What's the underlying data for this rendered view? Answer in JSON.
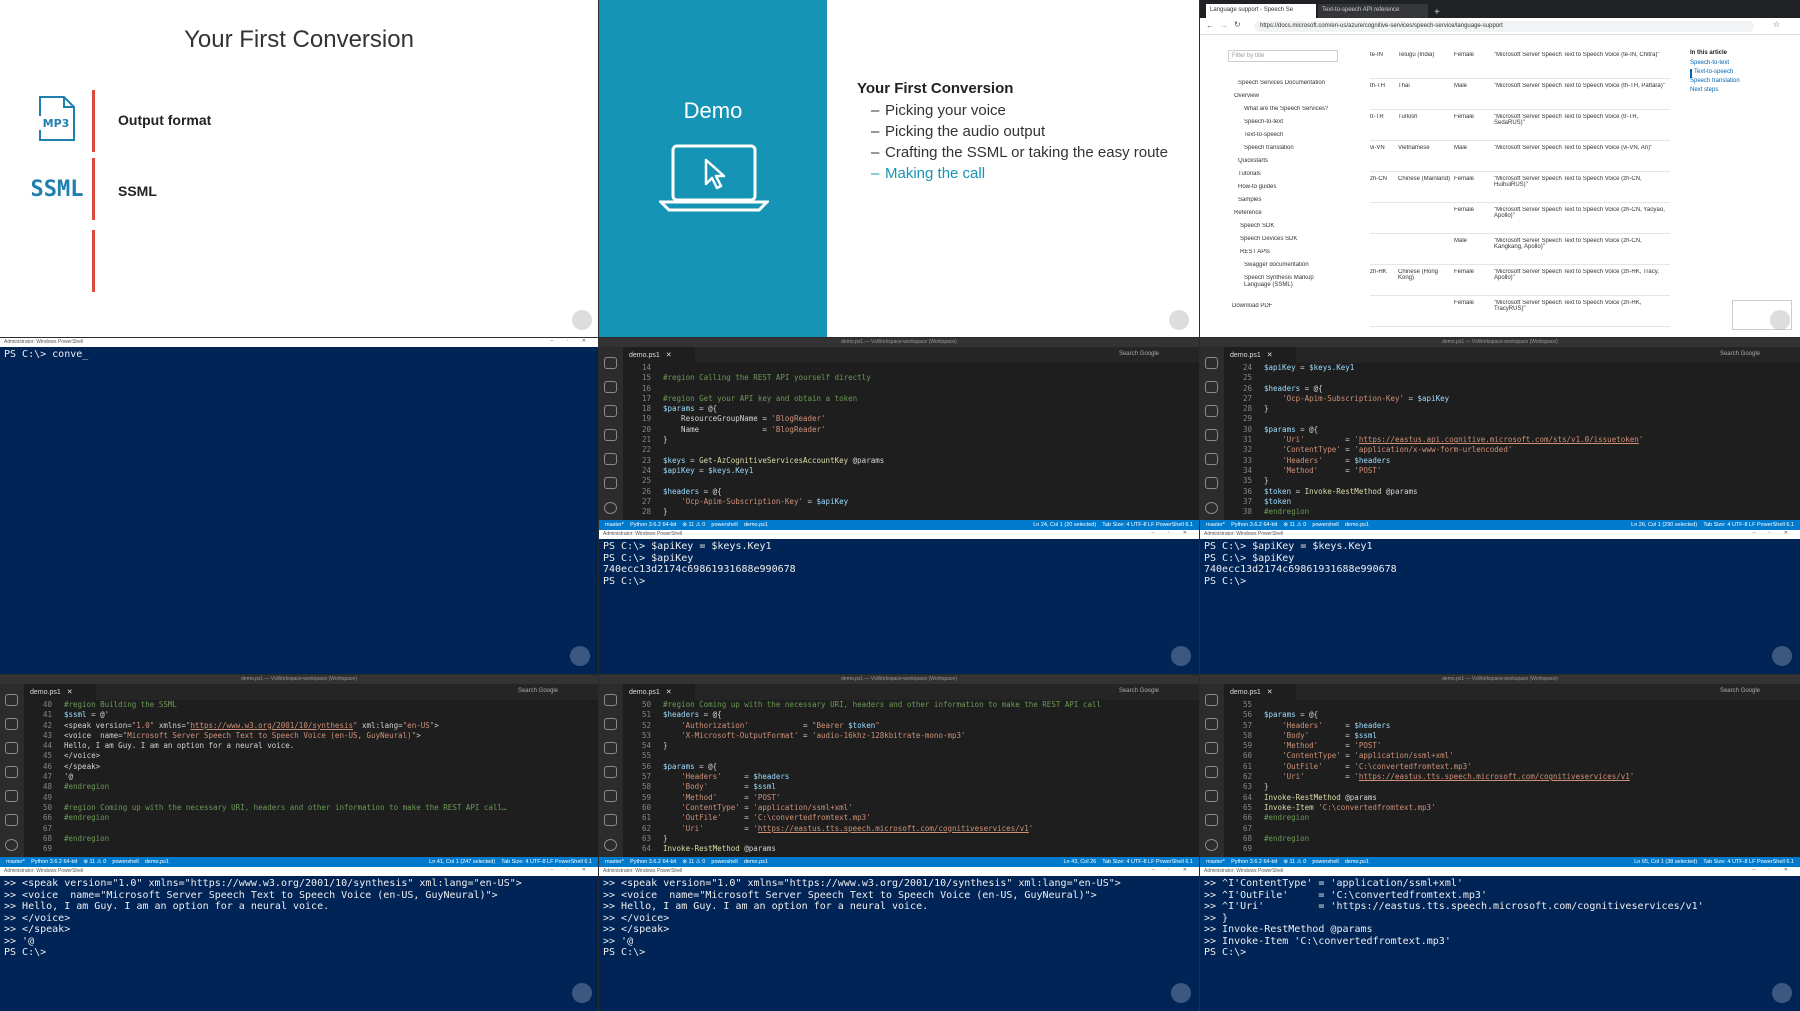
{
  "slide": {
    "title": "Your First Conversion",
    "items": [
      {
        "icon": "mp3-file-icon",
        "icon_text": "MP3",
        "label": "Output format"
      },
      {
        "icon": "ssml-icon",
        "icon_text": "SSML",
        "label": "SSML"
      }
    ]
  },
  "demo": {
    "word": "Demo",
    "heading": "Your First Conversion",
    "items": [
      "Picking your voice",
      "Picking the audio output",
      "Crafting the SSML or taking the easy route",
      "Making the call"
    ]
  },
  "browser": {
    "tabs": [
      "Language support - Speech Se",
      "Text-to-speech API reference"
    ],
    "url": "https://docs.microsoft.com/en-us/azure/cognitive-services/speech-service/language-support",
    "filter_placeholder": "Filter by title",
    "nav": [
      "Speech Services Documentation",
      "Overview",
      "What are the Speech Services?",
      "Speech-to-text",
      "Text-to-speech",
      "Speech translation",
      "Quickstarts",
      "Tutorials",
      "How-to guides",
      "Samples",
      "Reference",
      "Speech SDK",
      "Speech Devices SDK",
      "REST APIs",
      "Swagger documentation",
      "Speech Synthesis Markup Language (SSML)",
      "Download PDF"
    ],
    "rows": [
      {
        "locale": "te-IN",
        "lang": "Telugu (India)",
        "gender": "Female",
        "voice": "\"Microsoft Server Speech Text to Speech Voice (te-IN, Chitra)\""
      },
      {
        "locale": "th-TH",
        "lang": "Thai",
        "gender": "Male",
        "voice": "\"Microsoft Server Speech Text to Speech Voice (th-TH, Pattara)\""
      },
      {
        "locale": "tr-TR",
        "lang": "Turkish",
        "gender": "Female",
        "voice": "\"Microsoft Server Speech Text to Speech Voice (tr-TR, SedaRUS)\""
      },
      {
        "locale": "vi-VN",
        "lang": "Vietnamese",
        "gender": "Male",
        "voice": "\"Microsoft Server Speech Text to Speech Voice (vi-VN, An)\""
      },
      {
        "locale": "zh-CN",
        "lang": "Chinese (Mainland)",
        "gender": "Female",
        "voice": "\"Microsoft Server Speech Text to Speech Voice (zh-CN, HuihuiRUS)\""
      },
      {
        "locale": "",
        "lang": "",
        "gender": "Female",
        "voice": "\"Microsoft Server Speech Text to Speech Voice (zh-CN, Yaoyao, Apollo)\""
      },
      {
        "locale": "",
        "lang": "",
        "gender": "Male",
        "voice": "\"Microsoft Server Speech Text to Speech Voice (zh-CN, Kangkang, Apollo)\""
      },
      {
        "locale": "zh-HK",
        "lang": "Chinese (Hong Kong)",
        "gender": "Female",
        "voice": "\"Microsoft Server Speech Text to Speech Voice (zh-HK, Tracy, Apollo)\""
      },
      {
        "locale": "",
        "lang": "",
        "gender": "Female",
        "voice": "\"Microsoft Server Speech Text to Speech Voice (zh-HK, TracyRUS)\""
      }
    ],
    "toc_title": "In this article",
    "toc": [
      "Speech-to-text",
      "Text-to-speech",
      "Speech translation",
      "Next steps"
    ]
  },
  "ps1": {
    "title": "Administrator: Windows PowerShell",
    "lines": [
      "PS C:\\> conve_"
    ]
  },
  "vscode": {
    "window_title": "demo.ps1 — VsWorkspace-workspace (Workspace)",
    "tab": "demo.ps1",
    "search": "Search Google",
    "branch": "master*",
    "python": "Python 3.6.2 64-bit",
    "problems": "⊗ 11 ⚠ 0",
    "target": "powershell",
    "file": "demo.ps1",
    "status_right": "Tab Size: 4   UTF-8   LF   PowerShell   6.1"
  },
  "ed2": {
    "cursor": "Ln 24, Col 1 (20 selected)",
    "code": [
      [
        "14",
        ""
      ],
      [
        "15",
        "#region Calling the REST API yourself directly"
      ],
      [
        "16",
        ""
      ],
      [
        "17",
        "#region Get your API key and obtain a token"
      ],
      [
        "18",
        "$params = @{"
      ],
      [
        "19",
        "    ResourceGroupName = 'BlogReader'"
      ],
      [
        "20",
        "    Name              = 'BlogReader'"
      ],
      [
        "21",
        "}"
      ],
      [
        "22",
        ""
      ],
      [
        "23",
        "$keys = Get-AzCognitiveServicesAccountKey @params"
      ],
      [
        "24",
        "$apiKey = $keys.Key1"
      ],
      [
        "25",
        ""
      ],
      [
        "26",
        "$headers = @{"
      ],
      [
        "27",
        "    'Ocp-Apim-Subscription-Key' = $apiKey"
      ],
      [
        "28",
        "}"
      ]
    ]
  },
  "term2": {
    "title": "Administrator: Windows PowerShell",
    "lines": [
      "PS C:\\> $apiKey = $keys.Key1",
      "PS C:\\> $apiKey",
      "740ecc13d2174c69861931688e990678",
      "PS C:\\>"
    ]
  },
  "ed3": {
    "cursor": "Ln 26, Col 1 (290 selected)",
    "code": [
      [
        "24",
        "$apiKey = $keys.Key1"
      ],
      [
        "25",
        ""
      ],
      [
        "26",
        "$headers = @{"
      ],
      [
        "27",
        "    'Ocp-Apim-Subscription-Key' = $apiKey"
      ],
      [
        "28",
        "}"
      ],
      [
        "29",
        ""
      ],
      [
        "30",
        "$params = @{"
      ],
      [
        "31",
        "    'Uri'         = 'https://eastus.api.cognitive.microsoft.com/sts/v1.0/issuetoken'"
      ],
      [
        "32",
        "    'ContentType' = 'application/x-www-form-urlencoded'"
      ],
      [
        "33",
        "    'Headers'     = $headers"
      ],
      [
        "34",
        "    'Method'      = 'POST'"
      ],
      [
        "35",
        "}"
      ],
      [
        "36",
        "$token = Invoke-RestMethod @params"
      ],
      [
        "37",
        "$token"
      ],
      [
        "38",
        "#endregion"
      ]
    ]
  },
  "term3": {
    "title": "Administrator: Windows PowerShell",
    "lines": [
      "PS C:\\> $apiKey = $keys.Key1",
      "PS C:\\> $apiKey",
      "740ecc13d2174c69861931688e990678",
      "PS C:\\>"
    ]
  },
  "ed4": {
    "cursor": "Ln 41, Col 1 (247 selected)",
    "code": [
      [
        "40",
        "#region Building the SSML"
      ],
      [
        "41",
        "$ssml = @'"
      ],
      [
        "42",
        "<speak version=\"1.0\" xmlns=\"https://www.w3.org/2001/10/synthesis\" xml:lang=\"en-US\">"
      ],
      [
        "43",
        "<voice  name=\"Microsoft Server Speech Text to Speech Voice (en-US, GuyNeural)\">"
      ],
      [
        "44",
        "Hello, I am Guy. I am an option for a neural voice."
      ],
      [
        "45",
        "</voice>"
      ],
      [
        "46",
        "</speak>"
      ],
      [
        "47",
        "'@"
      ],
      [
        "48",
        "#endregion"
      ],
      [
        "49",
        ""
      ],
      [
        "50",
        "#region Coming up with the necessary URI, headers and other information to make the REST API call…"
      ],
      [
        "66",
        "#endregion"
      ],
      [
        "67",
        ""
      ],
      [
        "68",
        "#endregion"
      ],
      [
        "69",
        ""
      ]
    ]
  },
  "term4": {
    "title": "Administrator: Windows PowerShell",
    "lines": [
      ">> <speak version=\"1.0\" xmlns=\"https://www.w3.org/2001/10/synthesis\" xml:lang=\"en-US\">",
      ">> <voice  name=\"Microsoft Server Speech Text to Speech Voice (en-US, GuyNeural)\">",
      ">> Hello, I am Guy. I am an option for a neural voice.",
      ">> </voice>",
      ">> </speak>",
      ">> '@",
      "PS C:\\>"
    ]
  },
  "ed5": {
    "cursor": "Ln 43, Col 26",
    "code": [
      [
        "50",
        "#region Coming up with the necessary URI, headers and other information to make the REST API call"
      ],
      [
        "51",
        "$headers = @{"
      ],
      [
        "52",
        "    'Authorization'            = \"Bearer $token\""
      ],
      [
        "53",
        "    'X-Microsoft-OutputFormat' = 'audio-16khz-128kbitrate-mono-mp3'"
      ],
      [
        "54",
        "}"
      ],
      [
        "55",
        ""
      ],
      [
        "56",
        "$params = @{"
      ],
      [
        "57",
        "    'Headers'     = $headers"
      ],
      [
        "58",
        "    'Body'        = $ssml"
      ],
      [
        "59",
        "    'Method'      = 'POST'"
      ],
      [
        "60",
        "    'ContentType' = 'application/ssml+xml'"
      ],
      [
        "61",
        "    'OutFile'     = 'C:\\convertedfromtext.mp3'"
      ],
      [
        "62",
        "    'Uri'         = 'https://eastus.tts.speech.microsoft.com/cognitiveservices/v1'"
      ],
      [
        "63",
        "}"
      ],
      [
        "64",
        "Invoke-RestMethod @params"
      ],
      [
        "65",
        "Invoke-Item 'C:\\convertedfromtext.mp3'"
      ]
    ]
  },
  "term5": {
    "title": "Administrator: Windows PowerShell",
    "lines": [
      ">> <speak version=\"1.0\" xmlns=\"https://www.w3.org/2001/10/synthesis\" xml:lang=\"en-US\">",
      ">> <voice  name=\"Microsoft Server Speech Text to Speech Voice (en-US, GuyNeural)\">",
      ">> Hello, I am Guy. I am an option for a neural voice.",
      ">> </voice>",
      ">> </speak>",
      ">> '@",
      "PS C:\\>"
    ]
  },
  "ed6": {
    "cursor": "Ln 65, Col 1 (38 selected)",
    "code": [
      [
        "55",
        ""
      ],
      [
        "56",
        "$params = @{"
      ],
      [
        "57",
        "    'Headers'     = $headers"
      ],
      [
        "58",
        "    'Body'        = $ssml"
      ],
      [
        "59",
        "    'Method'      = 'POST'"
      ],
      [
        "60",
        "    'ContentType' = 'application/ssml+xml'"
      ],
      [
        "61",
        "    'OutFile'     = 'C:\\convertedfromtext.mp3'"
      ],
      [
        "62",
        "    'Uri'         = 'https://eastus.tts.speech.microsoft.com/cognitiveservices/v1'"
      ],
      [
        "63",
        "}"
      ],
      [
        "64",
        "Invoke-RestMethod @params"
      ],
      [
        "65",
        "Invoke-Item 'C:\\convertedfromtext.mp3'"
      ],
      [
        "66",
        "#endregion"
      ],
      [
        "67",
        ""
      ],
      [
        "68",
        "#endregion"
      ],
      [
        "69",
        ""
      ]
    ]
  },
  "term6": {
    "title": "Administrator: Windows PowerShell",
    "lines": [
      ">> ^I'ContentType' = 'application/ssml+xml'",
      ">> ^I'OutFile'     = 'C:\\convertedfromtext.mp3'",
      ">> ^I'Uri'         = 'https://eastus.tts.speech.microsoft.com/cognitiveservices/v1'",
      ">> }",
      ">> Invoke-RestMethod @params",
      ">> Invoke-Item 'C:\\convertedfromtext.mp3'",
      "PS C:\\>"
    ]
  }
}
